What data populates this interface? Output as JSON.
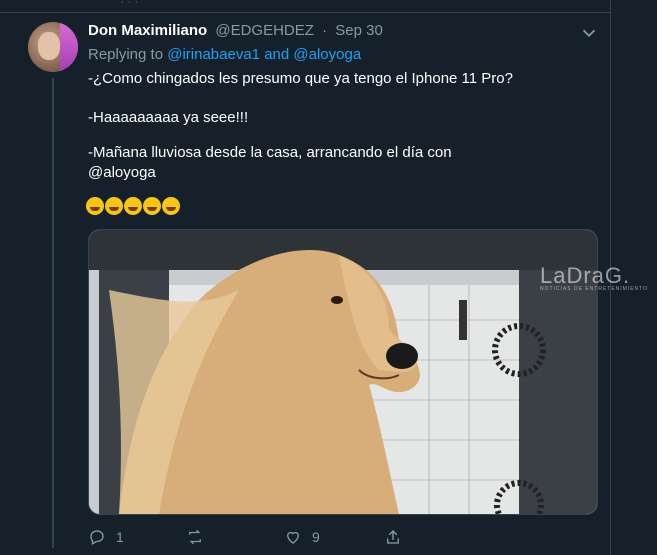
{
  "tweet": {
    "author_name": "Don Maximiliano",
    "handle": "@EDGEHDEZ",
    "separator": "·",
    "date": "Sep 30",
    "replying_to_label": "Replying to",
    "reply_user_1": "@irinabaeva1",
    "reply_and": "and",
    "reply_user_2": "@aloyoga",
    "line1": "-¿Como chingados les presumo que ya tengo el Iphone 11 Pro?",
    "line2": "-Haaaaaaaaa ya seee!!!",
    "line3": "-Mañana lluviosa desde la casa, arrancando el día con",
    "line4_mention": "@aloyoga",
    "emoji_count": 5,
    "watermark": "LaDraG.",
    "watermark_sub": "NOTICIAS DE ENTRETENIMIENTO"
  },
  "actions": {
    "reply_count": "1",
    "retweet_count": "",
    "like_count": "9"
  },
  "colors": {
    "background": "#15202b",
    "border": "#38444d",
    "muted": "#8899a6",
    "link": "#1da1f2"
  },
  "icons": {
    "more": "chevron-down-icon",
    "reply": "reply-icon",
    "retweet": "retweet-icon",
    "like": "heart-icon",
    "share": "share-icon"
  }
}
